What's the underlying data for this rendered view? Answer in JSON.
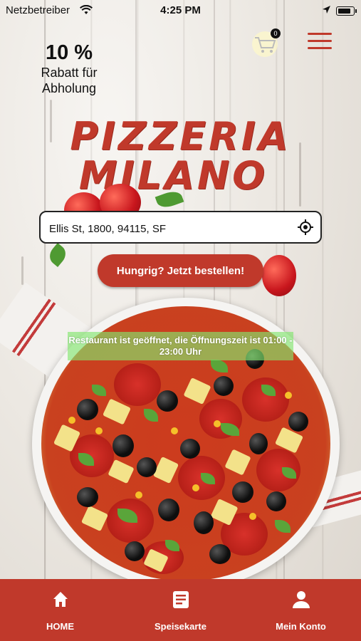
{
  "status_bar": {
    "carrier": "Netzbetreiber",
    "time": "4:25 PM"
  },
  "promo": {
    "percent": "10 %",
    "line1": "Rabatt für",
    "line2": "Abholung"
  },
  "cart": {
    "count": "0"
  },
  "logo": {
    "line1": "PIZZERIA",
    "line2": "MILANO"
  },
  "address": {
    "value": "Ellis St, 1800, 94115, SF"
  },
  "order_button": {
    "label": "Hungrig? Jetzt bestellen!"
  },
  "open_banner": {
    "text": "Restaurant ist geöffnet, die Öffnungszeit ist 01:00 - 23:00 Uhr"
  },
  "tabs": [
    {
      "label": "HOME",
      "icon": "home-icon"
    },
    {
      "label": "Speisekarte",
      "icon": "menu-card-icon"
    },
    {
      "label": "Mein Konto",
      "icon": "user-icon"
    }
  ],
  "colors": {
    "accent": "#c0392b",
    "banner": "#82e66e"
  }
}
